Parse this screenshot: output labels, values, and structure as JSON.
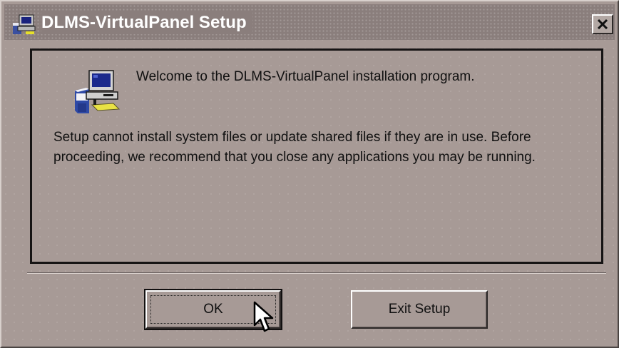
{
  "window": {
    "title": "DLMS-VirtualPanel Setup"
  },
  "icons": {
    "title_icon": "setup-computer-icon",
    "close_icon": "close-x-icon",
    "main_icon": "setup-computer-icon",
    "cursor": "mouse-pointer-icon"
  },
  "content": {
    "welcome": "Welcome to the DLMS-VirtualPanel installation program.",
    "message": "Setup cannot install system files or update shared files if they are in use. Before proceeding, we recommend that you close any applications you may be running."
  },
  "buttons": {
    "ok_label": "OK",
    "exit_label": "Exit Setup"
  },
  "colors": {
    "window_bg": "#a79a96",
    "titlebar_bg": "#8a7e7c",
    "title_text": "#ffffff"
  }
}
